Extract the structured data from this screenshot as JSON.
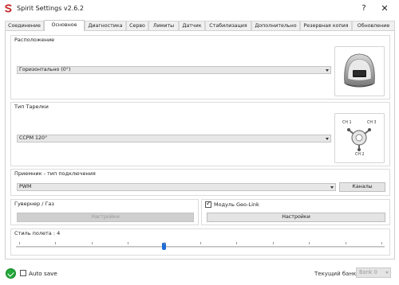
{
  "window": {
    "title": "Spirit Settings v2.6.2",
    "help_label": "?",
    "close_label": "✕"
  },
  "tabs": [
    {
      "label": "Соединение"
    },
    {
      "label": "Основное"
    },
    {
      "label": "Диагностика"
    },
    {
      "label": "Серво"
    },
    {
      "label": "Лимиты"
    },
    {
      "label": "Датчик"
    },
    {
      "label": "Стабилизация"
    },
    {
      "label": "Дополнительно"
    },
    {
      "label": "Резервная копия"
    },
    {
      "label": "Обновление"
    }
  ],
  "active_tab": "Основное",
  "orientation": {
    "label": "Расположение",
    "value": "Горизонтально (0°)",
    "image": "unit-horizontal-icon"
  },
  "swashplate": {
    "label": "Тип Тарелки",
    "value": "CCPM 120°",
    "image": "swashplate-ccpm-icon",
    "ch1": "CH 1",
    "ch2": "CH 2",
    "ch3": "CH 3"
  },
  "receiver": {
    "label": "Приемник - тип подключения",
    "value": "PWM",
    "channels_button": "Каналы"
  },
  "governor": {
    "label": "Гувернер / Газ",
    "settings_button": "Настройки",
    "settings_disabled": true
  },
  "geolink": {
    "label": "Модуль Geo-Link",
    "checked": true,
    "settings_button": "Настройки"
  },
  "flight_style": {
    "label": "Стиль полета : 4",
    "value": 4,
    "min": 0,
    "max": 10
  },
  "bottom": {
    "status_icon": "connected-check-icon",
    "autosave_label": "Auto save",
    "autosave_checked": false,
    "bank_label": "Текущий банк:",
    "bank_value": "Bank 0"
  },
  "colors": {
    "accent": "#1f6bd8",
    "status_ok": "#23a83a",
    "logo": "#c62828"
  }
}
